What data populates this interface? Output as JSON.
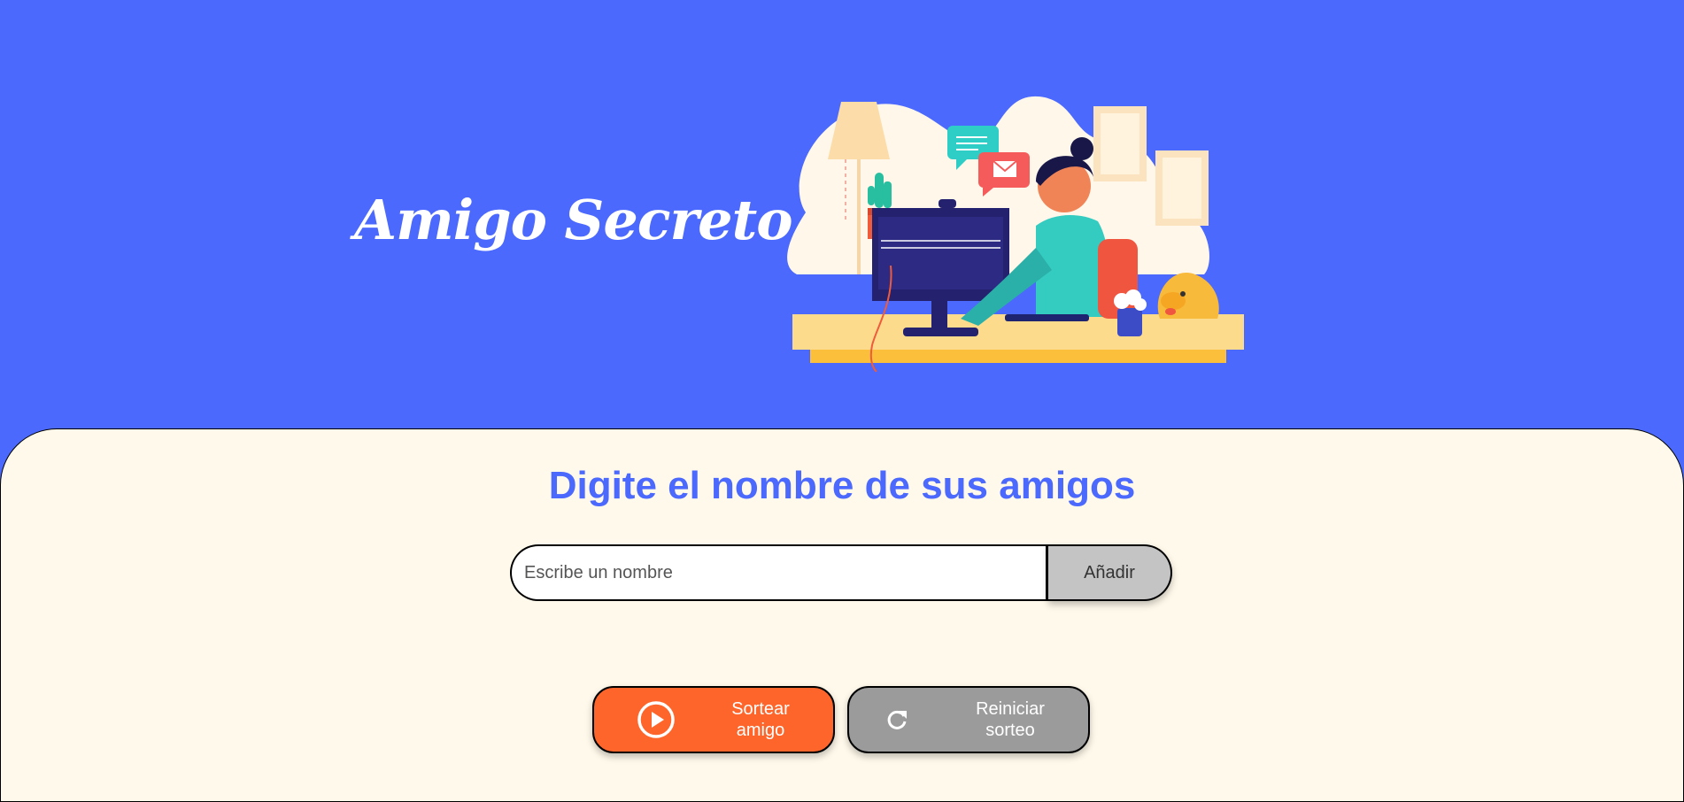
{
  "header": {
    "title": "Amigo Secreto",
    "illustration_icon": "person-at-computer-illustration"
  },
  "main": {
    "subtitle": "Digite el nombre de sus amigos",
    "name_input": {
      "value": "",
      "placeholder": "Escribe un nombre"
    },
    "add_button_label": "Añadir",
    "draw_button": {
      "line1": "Sortear",
      "line2": "amigo",
      "icon": "play-circle-icon"
    },
    "reset_button": {
      "line1": "Reiniciar",
      "line2": "sorteo",
      "icon": "refresh-icon"
    }
  },
  "colors": {
    "header_background": "#4B69FD",
    "panel_background": "#FFF9EB",
    "subtitle": "#4B69FD",
    "draw_button": "#FE652B",
    "reset_button": "#9B9B9B",
    "add_button": "#C4C4C4"
  }
}
